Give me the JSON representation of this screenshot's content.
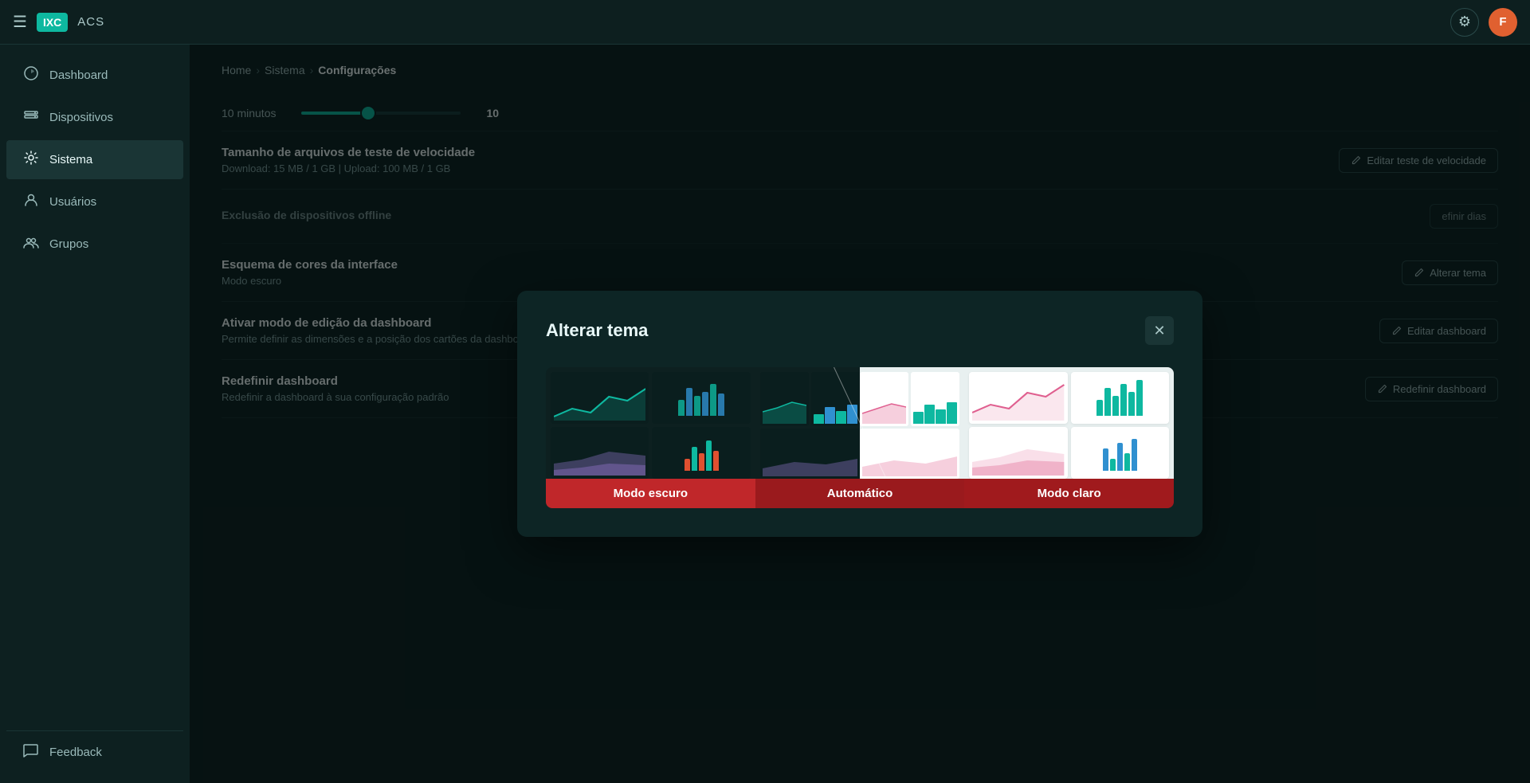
{
  "app": {
    "logo_box": "IXC",
    "logo_text": "ACS",
    "avatar_letter": "F"
  },
  "breadcrumb": {
    "home": "Home",
    "sep1": "›",
    "system": "Sistema",
    "sep2": "›",
    "current": "Configurações"
  },
  "sidebar": {
    "items": [
      {
        "id": "dashboard",
        "label": "Dashboard"
      },
      {
        "id": "dispositivos",
        "label": "Dispositivos"
      },
      {
        "id": "sistema",
        "label": "Sistema",
        "active": true
      },
      {
        "id": "usuarios",
        "label": "Usuários"
      },
      {
        "id": "grupos",
        "label": "Grupos"
      }
    ],
    "feedback_label": "Feedback"
  },
  "settings": {
    "slider": {
      "label": "10 minutos",
      "value": "10"
    },
    "speed_test": {
      "title": "Tamanho de arquivos de teste de velocidade",
      "desc": "Download: 15 MB / 1 GB | Upload: 100 MB / 1 GB",
      "btn_label": "Editar teste de velocidade"
    },
    "offline_exclusion": {
      "title_partial": "Exclusão de dispositivos offline",
      "btn_label_partial": "efinir dias"
    },
    "color_scheme": {
      "title": "Esquema de cores da interface",
      "desc": "Modo escuro",
      "btn_label": "Alterar tema"
    },
    "edit_dashboard": {
      "title": "Ativar modo de edição da dashboard",
      "desc": "Permite definir as dimensões e a posição dos cartões da dashboard",
      "btn_label": "Editar dashboard"
    },
    "reset_dashboard": {
      "title": "Redefinir dashboard",
      "desc": "Redefinir a dashboard à sua configuração padrão",
      "btn_label": "Redefinir dashboard"
    }
  },
  "modal": {
    "title": "Alterar tema",
    "themes": [
      {
        "id": "dark",
        "label": "Modo escuro",
        "active": true
      },
      {
        "id": "auto",
        "label": "Automático",
        "active": false
      },
      {
        "id": "light",
        "label": "Modo claro",
        "active": false
      }
    ]
  },
  "colors": {
    "accent": "#0eb8a0",
    "danger": "#c0272a",
    "bg_dark": "#0a2a2a",
    "bg_panel": "#0d2020"
  }
}
